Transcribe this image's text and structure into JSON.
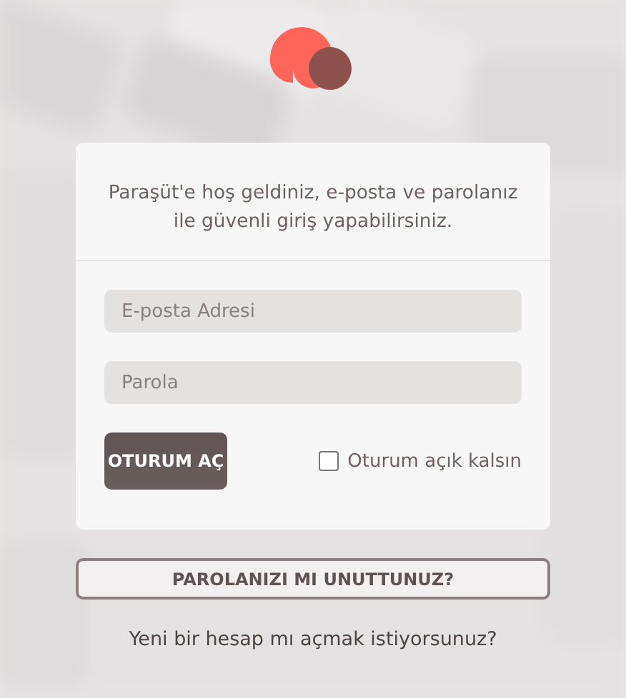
{
  "intro": "Paraşüt'e hoş geldiniz, e-posta ve parolanız ile güvenli giriş yapabilirsiniz.",
  "email": {
    "placeholder": "E-posta Adresi"
  },
  "password": {
    "placeholder": "Parola"
  },
  "login_button": "OTURUM AÇ",
  "remember": {
    "label": "Oturum açık kalsın",
    "checked": false
  },
  "forgot_button": "PAROLANIZI MI UNUTTUNUZ?",
  "signup_link": "Yeni bir hesap mı açmak istiyorsunuz?"
}
